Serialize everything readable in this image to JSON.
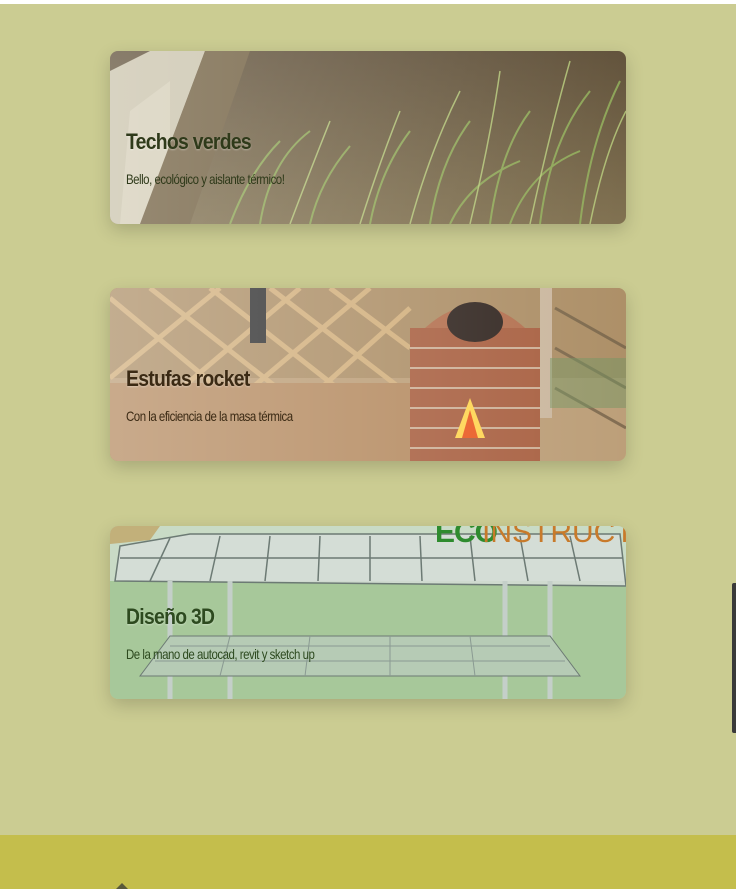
{
  "cards": [
    {
      "title": "Techos verdes",
      "subtitle": "Bello, ecológico y aislante térmico!",
      "image_subject": "green roof with grass and gravel"
    },
    {
      "title": "Estufas rocket",
      "subtitle": "Con la eficiencia de la masa térmica",
      "image_subject": "brick rocket stove with wooden lattice"
    },
    {
      "title": "Diseño 3D",
      "subtitle": "De la mano de autocad, revit y sketch up",
      "image_subject": "3D model of a roofed structure",
      "watermark": "ECOINSTRUCTIVA"
    }
  ],
  "colors": {
    "page_background": "#cbcc92",
    "footer_background": "#c4be4c"
  }
}
